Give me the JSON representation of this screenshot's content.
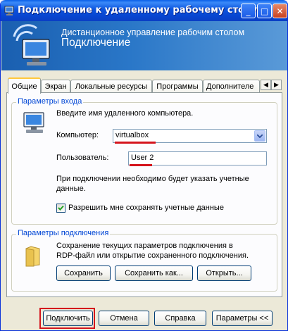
{
  "window": {
    "title": "Подключение к удаленному рабочему столу",
    "controls": {
      "minimize": "_",
      "maximize": "□",
      "close": "✕"
    }
  },
  "banner": {
    "line1": "Дистанционное управление рабочим столом",
    "line2": "Подключение"
  },
  "tabs": [
    {
      "label": "Общие",
      "active": true
    },
    {
      "label": "Экран"
    },
    {
      "label": "Локальные ресурсы"
    },
    {
      "label": "Программы"
    },
    {
      "label": "Дополнителе"
    }
  ],
  "tab_scroll": {
    "left": "◀",
    "right": "▶"
  },
  "login_group": {
    "title": "Параметры входа",
    "intro": "Введите имя удаленного компьютера.",
    "computer_label": "Компьютер:",
    "computer_value": "virtualbox",
    "user_label": "Пользователь:",
    "user_value": "User 2",
    "note_line1": "При подключении необходимо будет указать учетные",
    "note_line2": "данные.",
    "save_credentials_label": "Разрешить мне сохранять учетные данные",
    "save_credentials_checked": true
  },
  "connection_group": {
    "title": "Параметры подключения",
    "desc_line1": "Сохранение текущих параметров подключения в",
    "desc_line2": "RDP-файл или открытие сохраненного подключения.",
    "save_button": "Сохранить",
    "save_as_button": "Сохранить как...",
    "open_button": "Открыть..."
  },
  "footer": {
    "connect_button": "Подключить",
    "cancel_button": "Отмена",
    "help_button": "Справка",
    "options_button": "Параметры <<"
  },
  "colors": {
    "titlebar": "#0a53dd",
    "group_title": "#0046d5",
    "highlight": "#d4141c"
  }
}
